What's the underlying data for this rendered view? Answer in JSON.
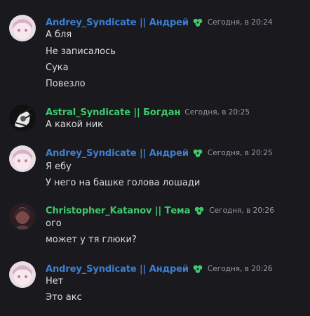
{
  "colors": {
    "background": "#1a1a1e",
    "blue_name": "#3b7fd4",
    "green_name": "#3ec96b",
    "timestamp": "#949ba4",
    "text": "#dbdee1"
  },
  "messages": [
    {
      "author": "Andrey_Syndicate || Андрей",
      "name_color": "blue",
      "role_icon": "green-clover-icon",
      "avatar": "anime-avatar-pink",
      "timestamp": "Сегодня, в 20:24",
      "lines": [
        "А бля",
        "Не записалось",
        "Сука",
        "Повезло"
      ]
    },
    {
      "author": "Astral_Syndicate || Богдан",
      "name_color": "green",
      "role_icon": "",
      "avatar": "dark-sketch-avatar",
      "timestamp": "Сегодня, в 20:25",
      "lines": [
        "А какой ник"
      ]
    },
    {
      "author": "Andrey_Syndicate || Андрей",
      "name_color": "blue",
      "role_icon": "green-clover-icon",
      "avatar": "anime-avatar-pink",
      "timestamp": "Сегодня, в 20:25",
      "lines": [
        "Я ебу",
        "У него на башке голова лошади"
      ]
    },
    {
      "author": "Christopher_Katanov || Тема",
      "name_color": "green",
      "role_icon": "green-clover-icon",
      "avatar": "dark-portrait-avatar",
      "timestamp": "Сегодня, в 20:26",
      "lines": [
        "ого",
        "может у тя глюки?"
      ]
    },
    {
      "author": "Andrey_Syndicate || Андрей",
      "name_color": "blue",
      "role_icon": "green-clover-icon",
      "avatar": "anime-avatar-pink",
      "timestamp": "Сегодня, в 20:26",
      "lines": [
        "Нет",
        "Это акс"
      ]
    }
  ]
}
